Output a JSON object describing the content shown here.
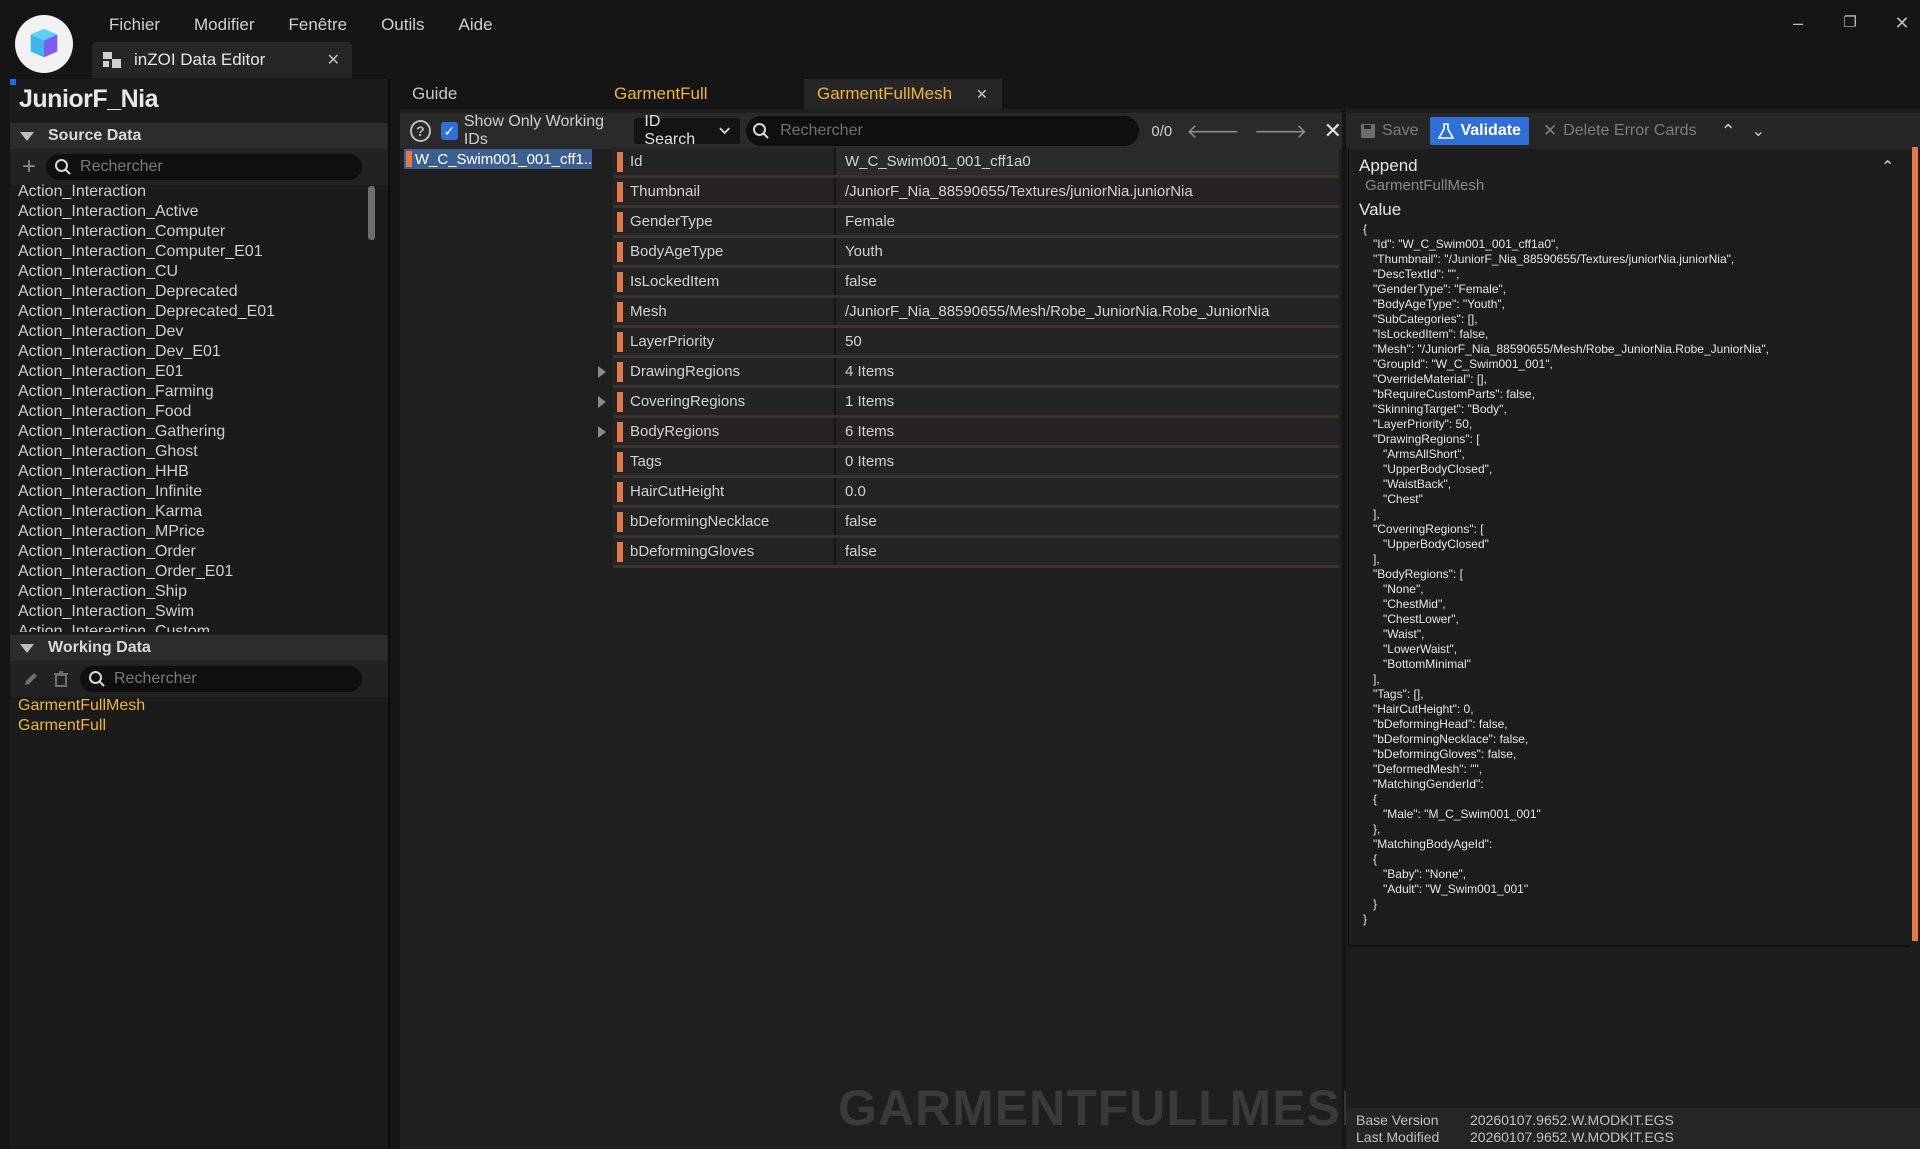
{
  "menu": [
    "Fichier",
    "Modifier",
    "Fenêtre",
    "Outils",
    "Aide"
  ],
  "document_tab": {
    "label": "inZOI Data Editor"
  },
  "window_controls": {
    "minimize": "–",
    "restore": "❐",
    "close": "✕"
  },
  "left": {
    "project": "JuniorF_Nia",
    "source": {
      "header": "Source Data",
      "search_placeholder": "Rechercher",
      "items": [
        "Action_Interaction",
        "Action_Interaction_Active",
        "Action_Interaction_Computer",
        "Action_Interaction_Computer_E01",
        "Action_Interaction_CU",
        "Action_Interaction_Deprecated",
        "Action_Interaction_Deprecated_E01",
        "Action_Interaction_Dev",
        "Action_Interaction_Dev_E01",
        "Action_Interaction_E01",
        "Action_Interaction_Farming",
        "Action_Interaction_Food",
        "Action_Interaction_Gathering",
        "Action_Interaction_Ghost",
        "Action_Interaction_HHB",
        "Action_Interaction_Infinite",
        "Action_Interaction_Karma",
        "Action_Interaction_MPrice",
        "Action_Interaction_Order",
        "Action_Interaction_Order_E01",
        "Action_Interaction_Ship",
        "Action_Interaction_Swim",
        "Action_Interaction_Custom"
      ]
    },
    "working": {
      "header": "Working Data",
      "search_placeholder": "Rechercher",
      "items": [
        "GarmentFullMesh",
        "GarmentFull"
      ]
    }
  },
  "center": {
    "tabs": [
      {
        "label": "Guide",
        "color": "#cfcfcf"
      },
      {
        "label": "GarmentFull",
        "color": "#f0b443"
      },
      {
        "label": "GarmentFullMesh",
        "color": "#f0b443",
        "active": true
      }
    ],
    "toolbar": {
      "show_only_label": "Show Only Working IDs",
      "id_search": "ID Search",
      "search_placeholder": "Rechercher",
      "counter": "0/0"
    },
    "selected_id": "W_C_Swim001_001_cff1...",
    "properties": [
      {
        "name": "Id",
        "value": "W_C_Swim001_001_cff1a0"
      },
      {
        "name": "Thumbnail",
        "value": "/JuniorF_Nia_88590655/Textures/juniorNia.juniorNia"
      },
      {
        "name": "GenderType",
        "value": "Female"
      },
      {
        "name": "BodyAgeType",
        "value": "Youth"
      },
      {
        "name": "IsLockedItem",
        "value": "false"
      },
      {
        "name": "Mesh",
        "value": "/JuniorF_Nia_88590655/Mesh/Robe_JuniorNia.Robe_JuniorNia"
      },
      {
        "name": "LayerPriority",
        "value": "50"
      },
      {
        "name": "DrawingRegions",
        "value": "4 Items",
        "expandable": true
      },
      {
        "name": "CoveringRegions",
        "value": "1 Items",
        "expandable": true
      },
      {
        "name": "BodyRegions",
        "value": "6 Items",
        "expandable": true
      },
      {
        "name": "Tags",
        "value": "0 Items"
      },
      {
        "name": "HairCutHeight",
        "value": "0.0"
      },
      {
        "name": "bDeformingNecklace",
        "value": "false"
      },
      {
        "name": "bDeformingGloves",
        "value": "false"
      }
    ],
    "watermark": "GARMENTFULLMESH"
  },
  "right": {
    "toolbar": {
      "save": "Save",
      "validate": "Validate",
      "delete": "Delete Error Cards"
    },
    "append": {
      "title": "Append",
      "subtitle": "GarmentFullMesh"
    },
    "value_label": "Value",
    "json_lines": [
      "{",
      "   \"Id\": \"W_C_Swim001_001_cff1a0\",",
      "   \"Thumbnail\": \"/JuniorF_Nia_88590655/Textures/juniorNia.juniorNia\",",
      "   \"DescTextId\": \"\",",
      "   \"GenderType\": \"Female\",",
      "   \"BodyAgeType\": \"Youth\",",
      "   \"SubCategories\": [],",
      "   \"IsLockedItem\": false,",
      "   \"Mesh\": \"/JuniorF_Nia_88590655/Mesh/Robe_JuniorNia.Robe_JuniorNia\",",
      "   \"GroupId\": \"W_C_Swim001_001\",",
      "   \"OverrideMaterial\": [],",
      "   \"bRequireCustomParts\": false,",
      "   \"SkinningTarget\": \"Body\",",
      "   \"LayerPriority\": 50,",
      "   \"DrawingRegions\": [",
      "      \"ArmsAllShort\",",
      "      \"UpperBodyClosed\",",
      "      \"WaistBack\",",
      "      \"Chest\"",
      "   ],",
      "   \"CoveringRegions\": [",
      "      \"UpperBodyClosed\"",
      "   ],",
      "   \"BodyRegions\": [",
      "      \"None\",",
      "      \"ChestMid\",",
      "      \"ChestLower\",",
      "      \"Waist\",",
      "      \"LowerWaist\",",
      "      \"BottomMinimal\"",
      "   ],",
      "   \"Tags\": [],",
      "   \"HairCutHeight\": 0,",
      "   \"bDeformingHead\": false,",
      "   \"bDeformingNecklace\": false,",
      "   \"bDeformingGloves\": false,",
      "   \"DeformedMesh\": \"\",",
      "   \"MatchingGenderId\":",
      "   {",
      "      \"Male\": \"M_C_Swim001_001\"",
      "   },",
      "   \"MatchingBodyAgeId\":",
      "   {",
      "      \"Baby\": \"None\",",
      "      \"Adult\": \"W_Swim001_001\"",
      "   }",
      "}"
    ],
    "version": {
      "base_label": "Base Version",
      "base_value": "20260107.9652.W.MODKIT.EGS",
      "modified_label": "Last Modified",
      "modified_value": "20260107.9652.W.MODKIT.EGS"
    }
  },
  "colors": {
    "accent_blue": "#2f6fd6",
    "orange": "#e07a4a",
    "working_yellow": "#f0b443"
  }
}
